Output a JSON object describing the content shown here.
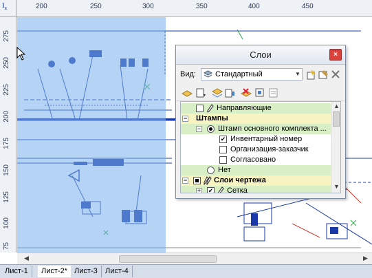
{
  "ruler": {
    "x_ticks": [
      "200",
      "250",
      "300",
      "350",
      "400",
      "450"
    ],
    "y_ticks": [
      "275",
      "250",
      "225",
      "200",
      "175",
      "150",
      "125",
      "100",
      "75"
    ]
  },
  "sheet_tabs": [
    "Лист-1",
    "Лист-2*",
    "Лист-3",
    "Лист-4"
  ],
  "active_tab_index": 1,
  "layers_panel": {
    "title": "Слои",
    "close_label": "×",
    "view_label": "Вид:",
    "view_value": "Стандартный",
    "tree": [
      {
        "label": "Направляющие",
        "state": "unchecked",
        "highlight": "green"
      },
      {
        "label": "Штампы",
        "state": "group",
        "highlight": "yellow",
        "bold": true
      },
      {
        "label": "Штамп основного комплекта ...",
        "state": "radio-on",
        "highlight": "green"
      },
      {
        "label": "Инвентарный номер",
        "state": "checked",
        "highlight": "none"
      },
      {
        "label": "Организация-заказчик",
        "state": "unchecked",
        "highlight": "none"
      },
      {
        "label": "Согласовано",
        "state": "unchecked",
        "highlight": "none"
      },
      {
        "label": "Нет",
        "state": "radio-off",
        "highlight": "green"
      },
      {
        "label": "Слои чертежа",
        "state": "filled",
        "highlight": "yellow",
        "bold": true
      },
      {
        "label": "Сетка",
        "state": "checked",
        "highlight": "green"
      }
    ]
  },
  "colors": {
    "selection": "#78afeb",
    "tree_green": "#d8efc6",
    "tree_yellow": "#f7f4c2",
    "drawing_blue": "#1a3aa8",
    "close_red": "#d9413a"
  }
}
